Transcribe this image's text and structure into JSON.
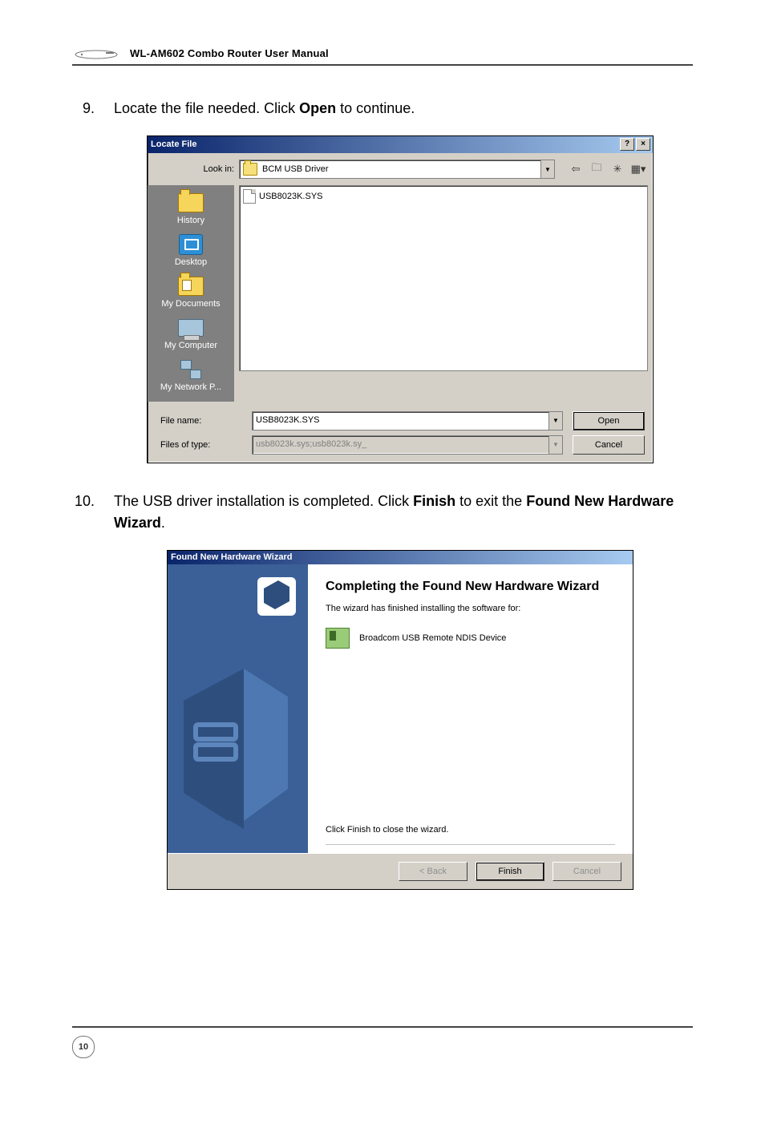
{
  "header": {
    "manual_title": "WL-AM602 Combo Router User Manual"
  },
  "steps": {
    "s9": {
      "num": "9.",
      "text_pre": "Locate the file needed. Click ",
      "bold1": "Open",
      "text_post": " to continue."
    },
    "s10": {
      "num": "10.",
      "text_pre": "The USB driver installation is completed. Click ",
      "bold1": "Finish",
      "text_mid": " to exit the ",
      "bold2": "Found New Hardware Wizard",
      "text_post": "."
    }
  },
  "locate_file": {
    "title": "Locate File",
    "help_btn": "?",
    "close_btn": "×",
    "lookin_label": "Look in:",
    "lookin_value": "BCM USB Driver",
    "tool_icons": {
      "back": "⇦",
      "up": "🗀",
      "new": "✳",
      "views": "▦▾"
    },
    "places": {
      "history": "History",
      "desktop": "Desktop",
      "documents": "My Documents",
      "computer": "My Computer",
      "network": "My Network P..."
    },
    "file_item": "USB8023K.SYS",
    "filename_label": "File name:",
    "filename_value": "USB8023K.SYS",
    "filetype_label": "Files of type:",
    "filetype_value": "usb8023k.sys;usb8023k.sy_",
    "open_btn": "Open",
    "cancel_btn": "Cancel"
  },
  "wizard": {
    "title": "Found New Hardware Wizard",
    "heading": "Completing the Found New Hardware Wizard",
    "subtext": "The wizard has finished installing the software for:",
    "device": "Broadcom USB Remote NDIS Device",
    "close_hint": "Click Finish to close the wizard.",
    "back_btn": "< Back",
    "finish_btn": "Finish",
    "cancel_btn": "Cancel"
  },
  "footer": {
    "page_number": "10"
  }
}
